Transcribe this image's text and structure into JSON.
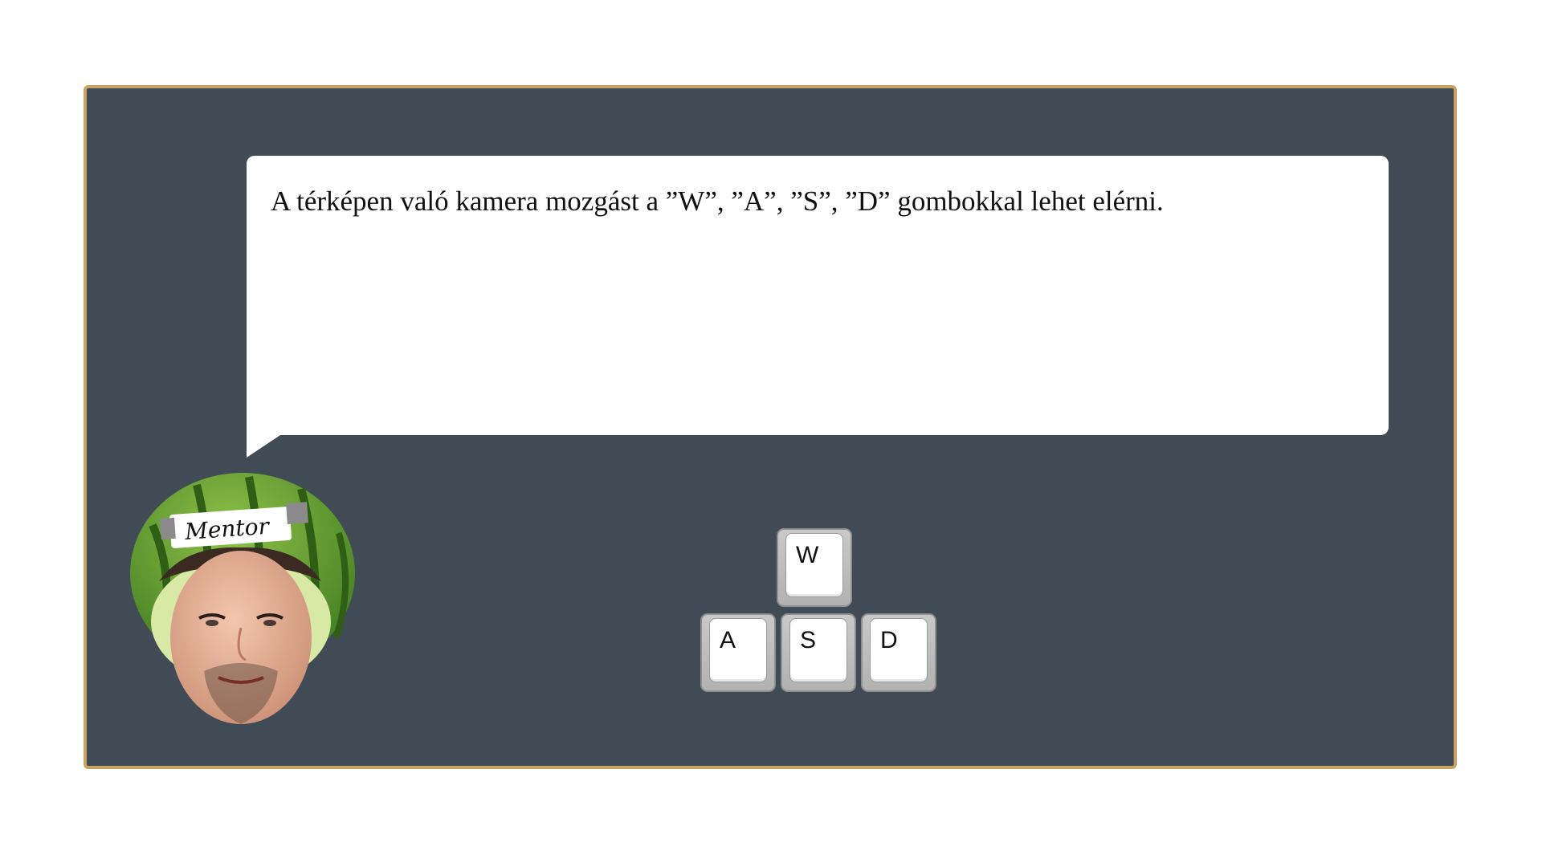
{
  "dialog": {
    "text": "A térképen való kamera mozgást a ”W”, ”A”, ”S”, ”D” gombokkal lehet elérni."
  },
  "mentor": {
    "badge": "Mentor"
  },
  "keys": {
    "w": "W",
    "a": "A",
    "s": "S",
    "d": "D"
  },
  "colors": {
    "panel": "#414b55",
    "panel_border": "#c9a463",
    "bubble": "#ffffff"
  }
}
